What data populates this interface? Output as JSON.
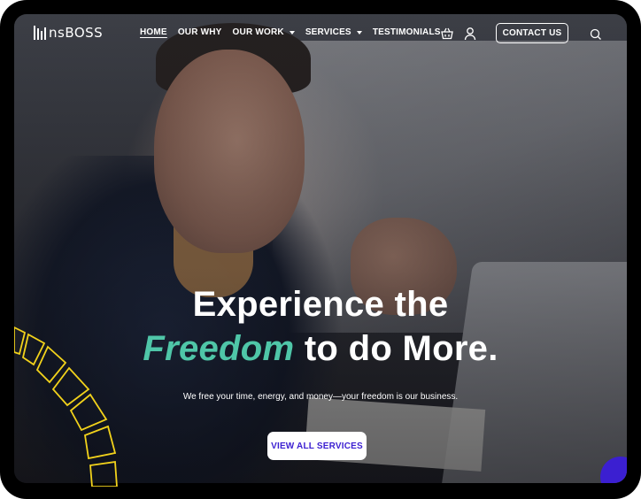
{
  "brand": {
    "logo_text": "nsBOSS"
  },
  "nav": {
    "items": [
      {
        "label": "HOME",
        "active": true,
        "has_dropdown": false
      },
      {
        "label": "OUR WHY",
        "active": false,
        "has_dropdown": false
      },
      {
        "label": "OUR WORK",
        "active": false,
        "has_dropdown": true
      },
      {
        "label": "SERVICES",
        "active": false,
        "has_dropdown": true
      },
      {
        "label": "TESTIMONIALS",
        "active": false,
        "has_dropdown": false
      }
    ]
  },
  "header": {
    "cart_icon": "shopping-basket-icon",
    "user_icon": "user-icon",
    "contact_label": "CONTACT US",
    "search_icon": "search-icon"
  },
  "hero": {
    "line1": "Experience the",
    "line2_emphasis": "Freedom",
    "line2_rest": "to do More.",
    "subtitle": "We free your time, energy, and money—your freedom is our business.",
    "cta_label": "VIEW ALL SERVICES"
  },
  "colors": {
    "accent_green": "#4fc6a8",
    "accent_purple": "#3b1fd1",
    "decor_yellow": "#f2d21b",
    "frame": "#000000"
  }
}
